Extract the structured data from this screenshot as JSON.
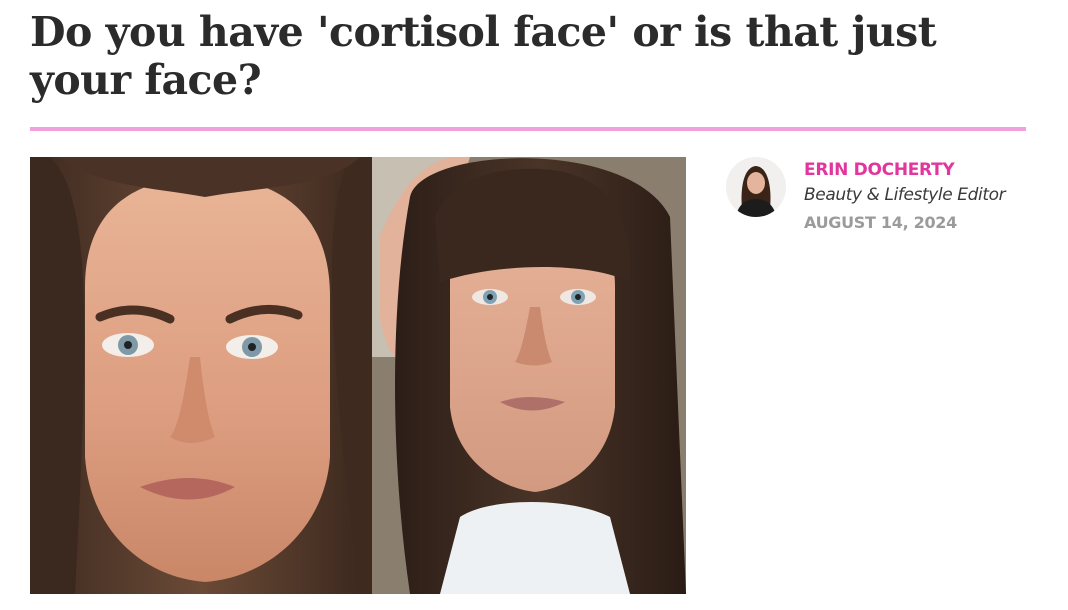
{
  "article": {
    "headline": "Do you have 'cortisol face' or is that just your face?",
    "hero_image": "side-by-side face comparison photo",
    "accent_color": "#f3a0df"
  },
  "author": {
    "name": "ERIN DOCHERTY",
    "role": "Beauty & Lifestyle Editor",
    "date": "AUGUST 14, 2024",
    "name_color": "#e2359e"
  }
}
